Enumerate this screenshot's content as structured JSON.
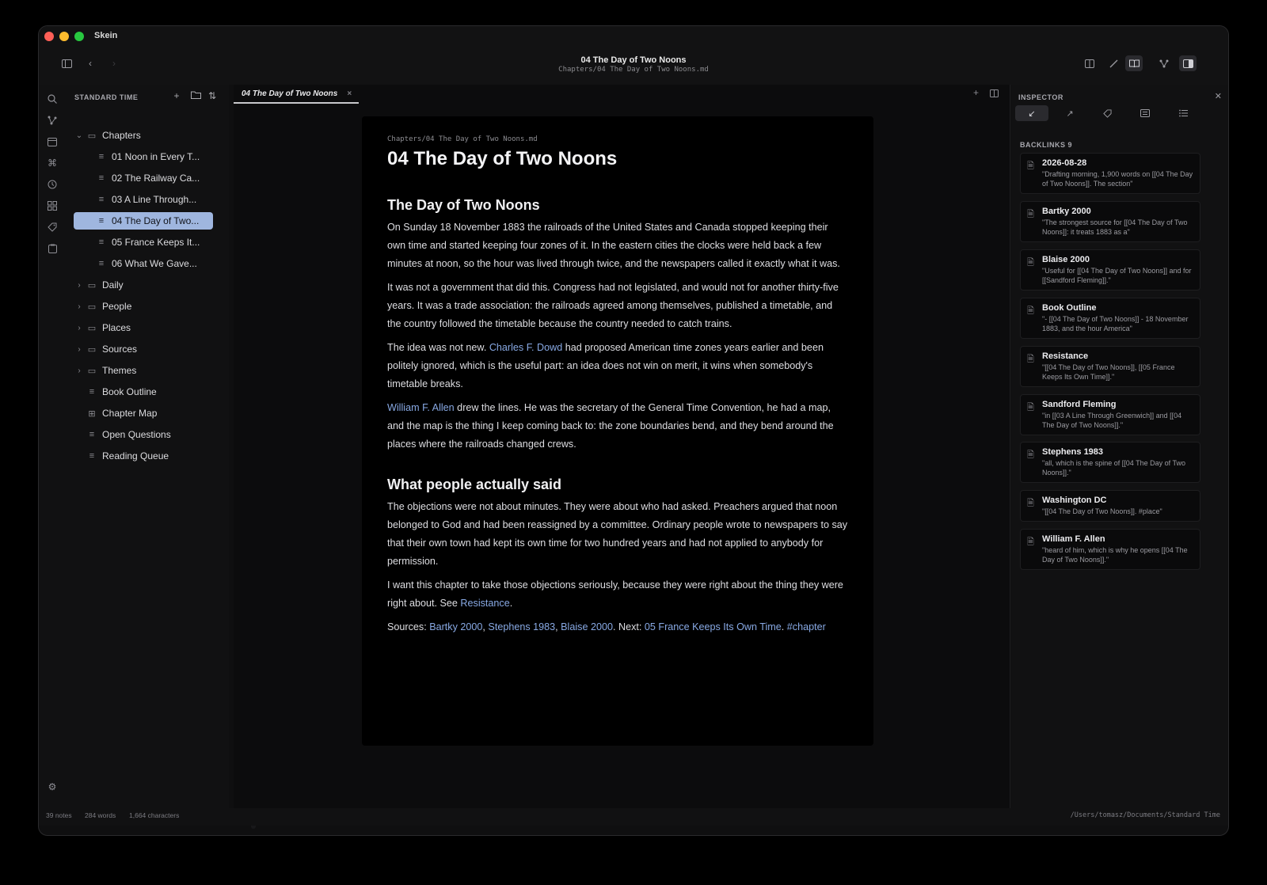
{
  "app": {
    "name": "Skein",
    "doc_title": "04 The Day of Two Noons",
    "doc_path": "Chapters/04 The Day of Two Noons.md"
  },
  "icons": {
    "toolbar_left": [
      "sidebar-toggle-icon",
      "back-icon",
      "forward-icon"
    ],
    "toolbar_right": [
      "split-view-icon",
      "edit-icon",
      "reading-icon",
      "graph-icon",
      "inspector-toggle-icon"
    ],
    "rail": [
      "search-icon",
      "graph-icon",
      "calendar-icon",
      "command-icon",
      "history-icon",
      "grid-icon",
      "tag-icon",
      "clipboard-icon"
    ]
  },
  "sidebar": {
    "header": "STANDARD TIME",
    "tree": [
      {
        "label": "Chapters",
        "kind": "folder",
        "expanded": true
      },
      {
        "label": "01 Noon in Every T...",
        "kind": "note"
      },
      {
        "label": "02 The Railway Ca...",
        "kind": "note"
      },
      {
        "label": "03 A Line Through...",
        "kind": "note"
      },
      {
        "label": "04 The Day of Two...",
        "kind": "note",
        "selected": true
      },
      {
        "label": "05 France Keeps It...",
        "kind": "note"
      },
      {
        "label": "06 What We Gave...",
        "kind": "note"
      },
      {
        "label": "Daily",
        "kind": "folder"
      },
      {
        "label": "People",
        "kind": "folder"
      },
      {
        "label": "Places",
        "kind": "folder"
      },
      {
        "label": "Sources",
        "kind": "folder"
      },
      {
        "label": "Themes",
        "kind": "folder"
      },
      {
        "label": "Book Outline",
        "kind": "note"
      },
      {
        "label": "Chapter Map",
        "kind": "canvas"
      },
      {
        "label": "Open Questions",
        "kind": "note"
      },
      {
        "label": "Reading Queue",
        "kind": "note"
      }
    ]
  },
  "editor": {
    "tab_label": "04 The Day of Two Noons",
    "tab_close": "×",
    "page_path": "Chapters/04 The Day of Two Noons.md",
    "h1": "04 The Day of Two Noons",
    "section1_title": "The Day of Two Noons",
    "p1": "On Sunday 18 November 1883 the railroads of the United States and Canada stopped keeping their own time and started keeping four zones of it. In the eastern cities the clocks were held back a few minutes at noon, so the hour was lived through twice, and the newspapers called it exactly what it was.",
    "p2": "It was not a government that did this. Congress had not legislated, and would not for another thirty-five years. It was a trade association: the railroads agreed among themselves, published a timetable, and the country followed the timetable because the country needed to catch trains.",
    "p3_pre": "The idea was not new. ",
    "p3_link": "Charles F. Dowd",
    "p3_post": " had proposed American time zones years earlier and been politely ignored, which is the useful part: an idea does not win on merit, it wins when somebody's timetable breaks.",
    "p4_link": "William F. Allen",
    "p4_post": " drew the lines. He was the secretary of the General Time Convention, he had a map, and the map is the thing I keep coming back to: the zone boundaries bend, and they bend around the places where the railroads changed crews.",
    "section2_title": "What people actually said",
    "p5": "The objections were not about minutes. They were about who had asked. Preachers argued that noon belonged to God and had been reassigned by a committee. Ordinary people wrote to newspapers to say that their own town had kept its own time for two hundred years and had not applied to anybody for permission.",
    "p6_pre": "I want this chapter to take those objections seriously, because they were right about the thing they were right about. See ",
    "p6_link": "Resistance",
    "p6_post": ".",
    "sources_pre": "Sources: ",
    "src1": "Bartky 2000",
    "sep1": ", ",
    "src2": "Stephens 1983",
    "sep2": ", ",
    "src3": "Blaise 2000",
    "next_pre": ". Next: ",
    "next_link": "05 France Keeps Its Own Time",
    "sep3": ". ",
    "tag": "#chapter"
  },
  "inspector": {
    "title": "INSPECTOR",
    "tabs": [
      "backlinks-icon",
      "outgoing-links-icon",
      "tags-icon",
      "properties-icon",
      "outline-icon"
    ],
    "backlinks_header": "BACKLINKS 9",
    "backlinks": [
      {
        "title": "2026-08-28",
        "excerpt": "\"Drafting morning, 1,900 words on [[04 The Day of Two Noons]]. The section\""
      },
      {
        "title": "Bartky 2000",
        "excerpt": "\"The strongest source for [[04 The Day of Two Noons]]: it treats 1883 as a\""
      },
      {
        "title": "Blaise 2000",
        "excerpt": "\"Useful for [[04 The Day of Two Noons]] and for [[Sandford Fleming]].\""
      },
      {
        "title": "Book Outline",
        "excerpt": "\"- [[04 The Day of Two Noons]] - 18 November 1883, and the hour America\""
      },
      {
        "title": "Resistance",
        "excerpt": "\"[[04 The Day of Two Noons]], [[05 France Keeps Its Own Time]].\""
      },
      {
        "title": "Sandford Fleming",
        "excerpt": "\"in [[03 A Line Through Greenwich]] and [[04 The Day of Two Noons]].\""
      },
      {
        "title": "Stephens 1983",
        "excerpt": "\"all, which is the spine of [[04 The Day of Two Noons]].\""
      },
      {
        "title": "Washington DC",
        "excerpt": "\"[[04 The Day of Two Noons]]. #place\""
      },
      {
        "title": "William F. Allen",
        "excerpt": "\"heard of him, which is why he opens [[04 The Day of Two Noons]].\""
      }
    ]
  },
  "status": {
    "notes": "39 notes",
    "words": "284 words",
    "characters": "1,664 characters",
    "vault_path": "/Users/tomasz/Documents/Standard Time"
  }
}
